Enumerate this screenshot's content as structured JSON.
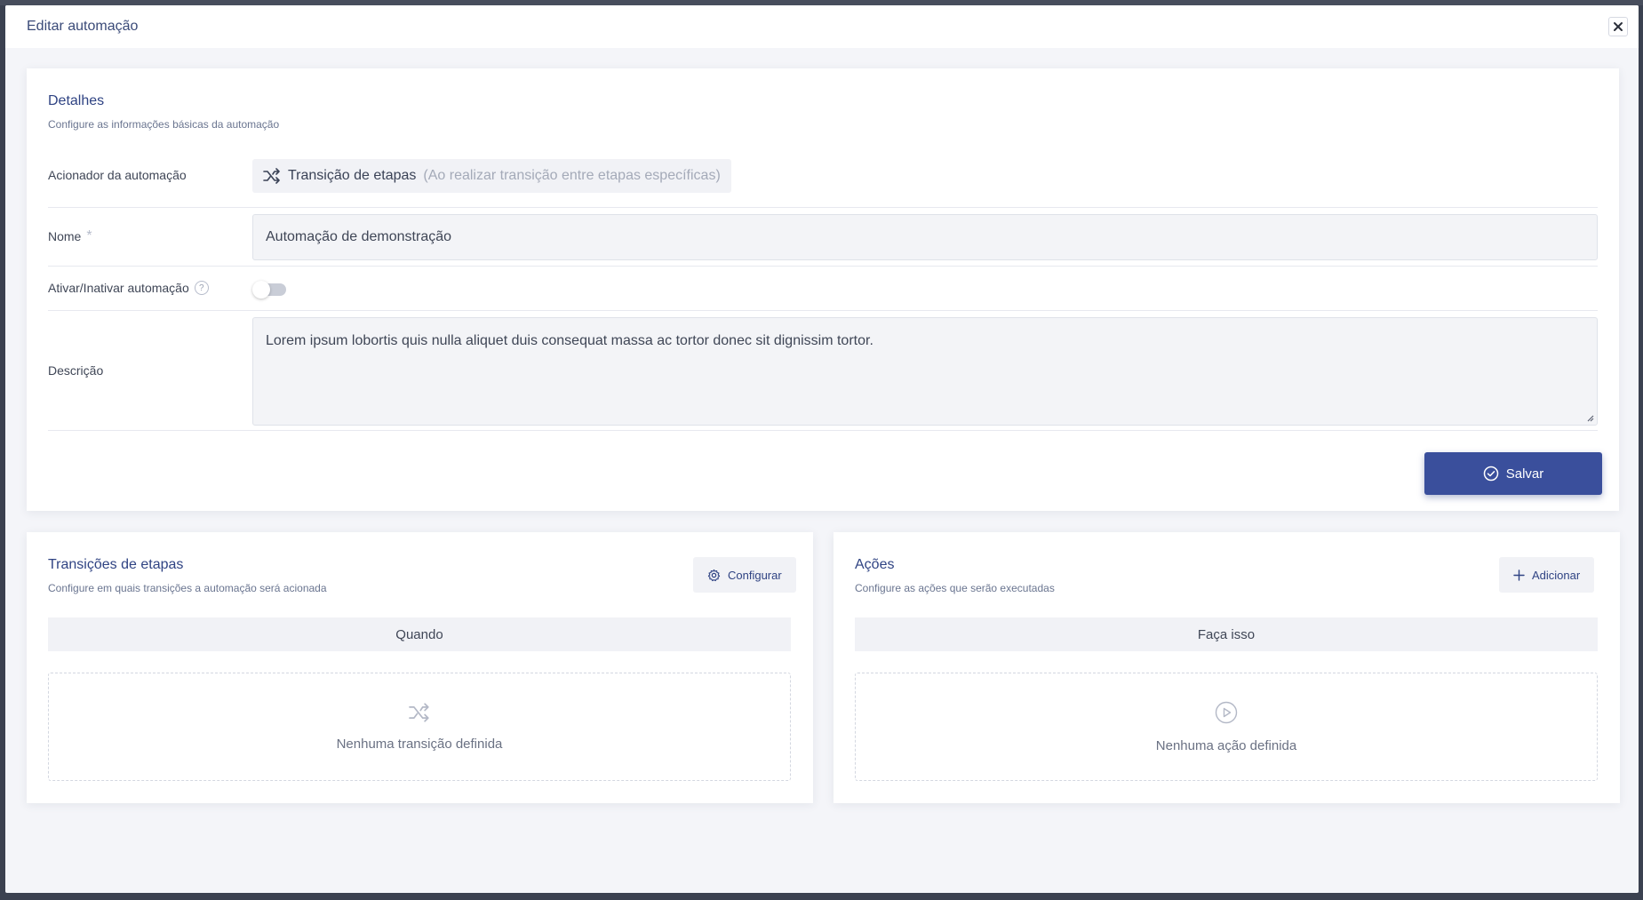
{
  "modal": {
    "title": "Editar automação"
  },
  "details": {
    "title": "Detalhes",
    "subtitle": "Configure as informações básicas da automação",
    "trigger": {
      "label": "Acionador da automação",
      "value": "Transição de etapas",
      "hint": "(Ao realizar transição entre etapas específicas)",
      "icon": "shuffle-icon"
    },
    "name": {
      "label": "Nome",
      "required_mark": "*",
      "value": "Automação de demonstração"
    },
    "active": {
      "label": "Ativar/Inativar automação",
      "help": "?",
      "enabled": false
    },
    "description": {
      "label": "Descrição",
      "value": "Lorem ipsum lobortis quis nulla aliquet duis consequat massa ac tortor donec sit dignissim tortor."
    },
    "save_label": "Salvar"
  },
  "transitions": {
    "title": "Transições de etapas",
    "subtitle": "Configure em quais transições a automação será acionada",
    "button_label": "Configurar",
    "bar_label": "Quando",
    "empty_text": "Nenhuma transição definida"
  },
  "actions": {
    "title": "Ações",
    "subtitle": "Configure as ações que serão executadas",
    "button_label": "Adicionar",
    "bar_label": "Faça isso",
    "empty_text": "Nenhuma ação definida"
  },
  "colors": {
    "primary": "#3a4f9c",
    "heading": "#2f4383",
    "background": "#f4f5f9"
  }
}
